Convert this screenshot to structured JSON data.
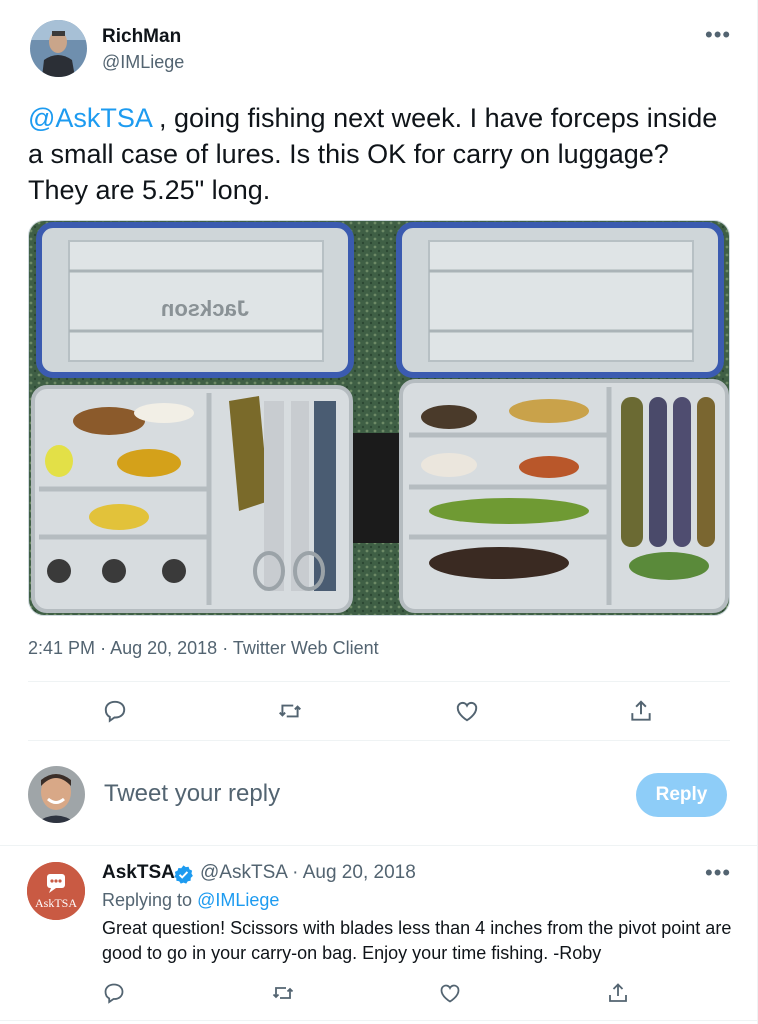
{
  "tweet": {
    "author_name": "RichMan",
    "author_handle": "@IMLiege",
    "mention": "@AskTSA",
    "text": " , going fishing next week. I have forceps inside a small case of lures. Is this OK for carry on luggage? They are 5.25\" long.",
    "image_brand_text": "Jackson",
    "time": "2:41 PM",
    "date": "Aug 20, 2018",
    "client": "Twitter Web Client",
    "more_icon": "more-horizontal-icon"
  },
  "actions": [
    "reply-icon",
    "retweet-icon",
    "like-icon",
    "share-icon"
  ],
  "composer": {
    "placeholder": "Tweet your reply",
    "button_label": "Reply"
  },
  "reply": {
    "author_name": "AskTSA",
    "author_handle": "@AskTSA",
    "date": "Aug 20, 2018",
    "avatar_label": "AskTSA",
    "replying_prefix": "Replying to",
    "replying_to": "@IMLiege",
    "text": "Great question! Scissors with blades less than 4 inches from the pivot point are good to go in your carry-on bag. Enjoy your time fishing. -Roby"
  },
  "colors": {
    "accent": "#1d9bf0",
    "reply_button_disabled": "#8ecdf8",
    "secondary_text": "#536471",
    "tsa_avatar": "#c95a43"
  }
}
